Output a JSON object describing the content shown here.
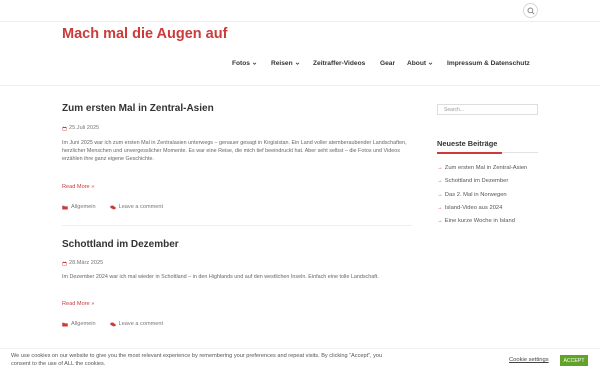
{
  "site": {
    "title": "Mach mal die Augen auf"
  },
  "nav": {
    "items": [
      {
        "label": "Fotos",
        "has_dropdown": true
      },
      {
        "label": "Reisen",
        "has_dropdown": true
      },
      {
        "label": "Zeitraffer-Videos",
        "has_dropdown": false
      },
      {
        "label": "Gear",
        "has_dropdown": false
      },
      {
        "label": "About",
        "has_dropdown": true
      },
      {
        "label": "Impressum & Datenschutz",
        "has_dropdown": false
      }
    ]
  },
  "posts": [
    {
      "title": "Zum ersten Mal in Zentral-Asien",
      "date": "25.Juli 2025",
      "excerpt": "Im Juni 2025 war ich zum ersten Mal in Zentralasien unterwegs – genauer gesagt in Kirgisistan. Ein Land voller atemberaubender Landschaften, herzlicher Menschen und unvergesslicher Momente. Es war eine Reise, die mich tief beeindruckt hat. Aber seht selbst – die Fotos und Videos erzählen ihre ganz eigene Geschichte.",
      "read_more": "Read More »",
      "category": "Allgemein",
      "comments": "Leave a comment"
    },
    {
      "title": "Schottland im Dezember",
      "date": "28.März 2025",
      "excerpt": "Im Dezember 2024 war ich mal wieder in Schottland – in den Highlands und auf den westlichen Inseln. Einfach eine tolle Landschaft.",
      "read_more": "Read More »",
      "category": "Allgemein",
      "comments": "Leave a comment"
    }
  ],
  "sidebar": {
    "search_placeholder": "Search...",
    "widget_title": "Neueste Beiträge",
    "recent_posts": [
      "Zum ersten Mal in Zentral-Asien",
      "Schottland im Dezember",
      "Das 2. Mal in Norwegen",
      "Island-Video aus 2024",
      "Eine kurze Woche in Island"
    ]
  },
  "cookie": {
    "text": "We use cookies on our website to give you the most relevant experience by remembering your preferences and repeat visits. By clicking “Accept”, you consent to the use of ALL the cookies.",
    "settings_label": "Cookie settings",
    "accept_label": "ACCEPT"
  },
  "colors": {
    "accent": "#cc3a3a",
    "accept": "#61a229",
    "text": "#555555"
  },
  "icons": {
    "search": "search-icon",
    "chevron": "chevron-down-icon",
    "calendar": "calendar-icon",
    "folder": "folder-icon",
    "comments": "comments-icon",
    "arrow": "arrow-right-icon"
  }
}
